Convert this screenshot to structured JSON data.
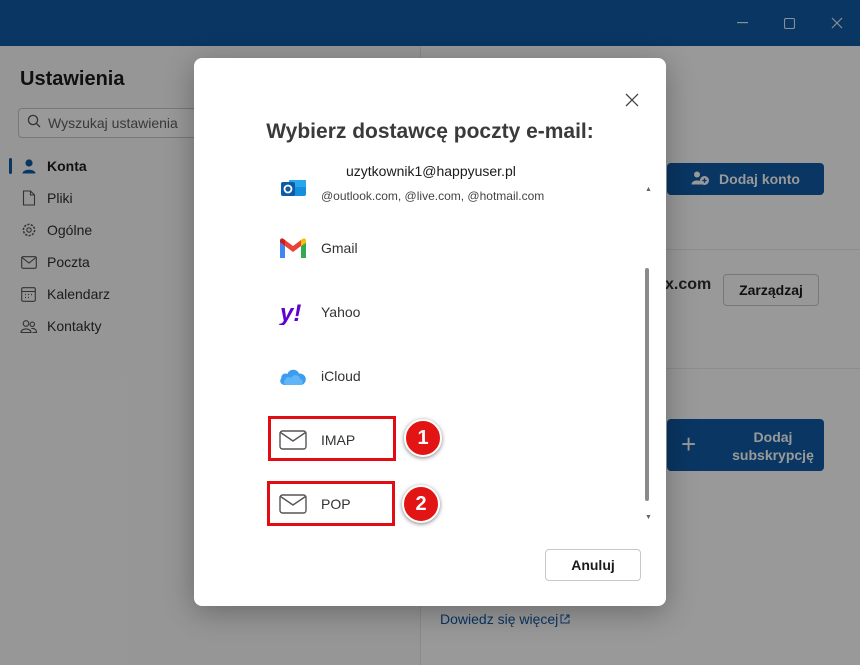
{
  "window": {
    "minimize_icon": "minimize-icon",
    "maximize_icon": "maximize-icon",
    "close_icon": "close-icon"
  },
  "settings": {
    "title": "Ustawienia",
    "search_placeholder": "Wyszukaj ustawienia",
    "nav": [
      {
        "label": "Konta",
        "icon": "person-icon",
        "active": true
      },
      {
        "label": "Pliki",
        "icon": "file-icon"
      },
      {
        "label": "Ogólne",
        "icon": "gear-icon"
      },
      {
        "label": "Poczta",
        "icon": "mail-icon"
      },
      {
        "label": "Kalendarz",
        "icon": "calendar-icon"
      },
      {
        "label": "Kontakty",
        "icon": "people-icon"
      }
    ],
    "add_account_label": "Dodaj konto",
    "account_suffix": "x.com",
    "manage_label": "Zarządzaj",
    "add_subscription_label": "Dodaj subskrypcję",
    "learn_more": "Dowiedz się więcej"
  },
  "dialog": {
    "title": "Wybierz dostawcę poczty e-mail:",
    "outlook": {
      "user": "uzytkownik1@happyuser.pl",
      "domains": "@outlook.com, @live.com, @hotmail.com"
    },
    "providers": [
      {
        "name": "Gmail",
        "icon": "gmail-icon"
      },
      {
        "name": "Yahoo",
        "icon": "yahoo-icon"
      },
      {
        "name": "iCloud",
        "icon": "icloud-icon"
      },
      {
        "name": "IMAP",
        "icon": "mail-icon"
      },
      {
        "name": "POP",
        "icon": "mail-icon"
      }
    ],
    "cancel_label": "Anuluj"
  },
  "annotations": {
    "badge_1": "1",
    "badge_2": "2",
    "highlight_color": "#e10d12"
  },
  "colors": {
    "accent": "#0f5aa6",
    "badge": "#e31414"
  }
}
